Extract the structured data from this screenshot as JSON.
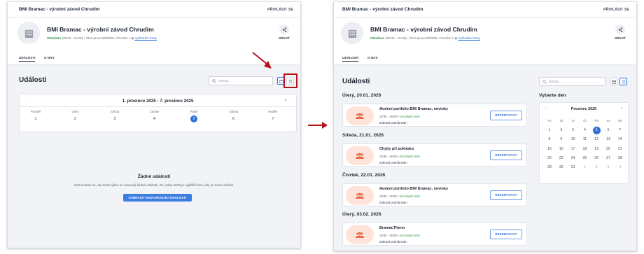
{
  "app": {
    "title": "BMI Bramac - výrobní závod Chrudim",
    "login": "PŘIHLÁSIT SE"
  },
  "header": {
    "name": "BMI Bramac - výrobní závod Chrudim",
    "status": "Otevřeno",
    "hours": "(08:00 - 15:00)",
    "address": "Škroupova 808/808, Chrudim 1",
    "navigate": "Vyhledání trasy",
    "share": "SDÍLET"
  },
  "tabs": [
    "UDÁLOSTI",
    "O NÁS"
  ],
  "page_title": "Události",
  "search_placeholder": "Hledat...",
  "icons": {
    "building": "building-icon",
    "share": "share-icon",
    "search": "search-icon",
    "calendar_view": "calendar-icon",
    "list_view": "list-icon",
    "people": "people-icon"
  },
  "colors": {
    "accent": "#2f6fd8",
    "highlight": "#b3151a",
    "open": "#1d8a3a",
    "event_image": "#fde3d9"
  },
  "week": {
    "title": "1. prosince 2025 - 7. prosince 2025",
    "prev": "‹",
    "next": "›",
    "days": [
      {
        "name": "Pondělí",
        "num": "1"
      },
      {
        "name": "Úterý",
        "num": "2"
      },
      {
        "name": "Středa",
        "num": "3"
      },
      {
        "name": "Čtvrtek",
        "num": "4"
      },
      {
        "name": "Pátek",
        "num": "5"
      },
      {
        "name": "Sobota",
        "num": "6"
      },
      {
        "name": "Neděle",
        "num": "7"
      }
    ]
  },
  "empty": {
    "title": "Žádné události",
    "desc": "Omlouváme se, ale tento týden se nekonají žádné události. 20. ledna 2026 je nejbližší den, kdy se koná událost.",
    "button": "ZOBRAZIT NADCHÁZEJÍCÍ UDÁLOSTI"
  },
  "events_groups": [
    {
      "date": "Úterý, 20.01. 2026",
      "event": {
        "title": "školení portfolio BMI Bramac, novinky",
        "time": "10:00 - 16:00",
        "free": "15 volných míst",
        "details": "Zobrazit podrobnosti",
        "book": "REZERVOVAT"
      }
    },
    {
      "date": "Středa, 21.01. 2026",
      "event": {
        "title": "Chyby při pokládce",
        "time": "10:00 - 16:00",
        "free": "15 volných míst",
        "details": "Zobrazit podrobnosti",
        "book": "REZERVOVAT"
      }
    },
    {
      "date": "Čtvrtek, 22.01. 2026",
      "event": {
        "title": "školení portfolio BMI Bramac, novinky",
        "time": "10:00 - 16:00",
        "free": "15 volných míst",
        "details": "Zobrazit podrobnosti",
        "book": "REZERVOVAT"
      }
    },
    {
      "date": "Úterý, 03.02. 2026",
      "event": {
        "title": "BramacTherm",
        "time": "10:00 - 16:00",
        "free": "15 volných míst",
        "details": "Zobrazit podrobnosti",
        "book": "REZERVOVAT"
      }
    }
  ],
  "month": {
    "select_label": "Vyberte den",
    "title": "Prosinec 2025",
    "prev": "‹",
    "next": "›",
    "headers": [
      "Po",
      "Út",
      "St",
      "Čt",
      "Pá",
      "So",
      "Ne"
    ],
    "weeks": [
      [
        "1",
        "2",
        "3",
        "4",
        "5",
        "6",
        "7"
      ],
      [
        "8",
        "9",
        "10",
        "11",
        "12",
        "13",
        "14"
      ],
      [
        "15",
        "16",
        "17",
        "18",
        "19",
        "20",
        "21"
      ],
      [
        "22",
        "23",
        "24",
        "25",
        "26",
        "27",
        "28"
      ],
      [
        "29",
        "30",
        "31",
        "1",
        "2",
        "3",
        "4"
      ]
    ],
    "today": "5"
  }
}
